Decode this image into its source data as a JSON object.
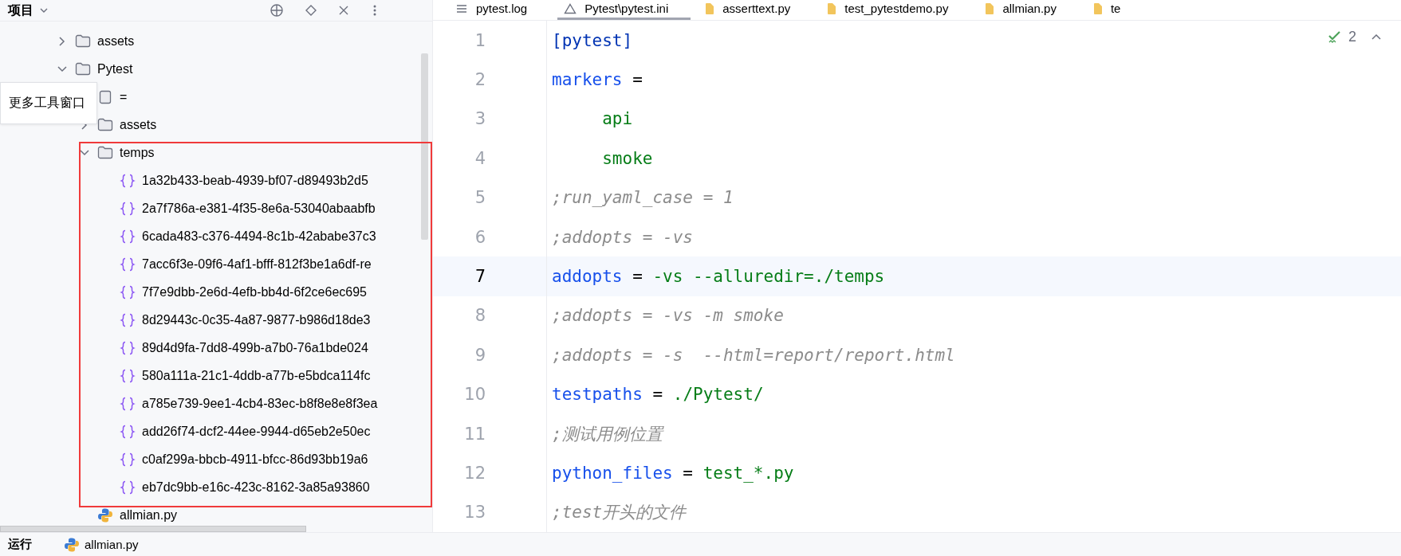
{
  "project_panel": {
    "title": "项目"
  },
  "tree": [
    {
      "label": "assets",
      "kind": "folder",
      "expanded": false
    },
    {
      "label": "Pytest",
      "kind": "folder",
      "expanded": true,
      "children": [
        {
          "label": "=",
          "kind": "file"
        },
        {
          "label": "assets",
          "kind": "folder",
          "expanded": false
        },
        {
          "label": "temps",
          "kind": "folder",
          "expanded": true,
          "children": [
            {
              "label": "1a32b433-beab-4939-bf07-d89493b2d5",
              "kind": "json"
            },
            {
              "label": "2a7f786a-e381-4f35-8e6a-53040abaabfb",
              "kind": "json"
            },
            {
              "label": "6cada483-c376-4494-8c1b-42ababe37c3",
              "kind": "json"
            },
            {
              "label": "7acc6f3e-09f6-4af1-bfff-812f3be1a6df-re",
              "kind": "json"
            },
            {
              "label": "7f7e9dbb-2e6d-4efb-bb4d-6f2ce6ec695",
              "kind": "json"
            },
            {
              "label": "8d29443c-0c35-4a87-9877-b986d18de3",
              "kind": "json"
            },
            {
              "label": "89d4d9fa-7dd8-499b-a7b0-76a1bde024",
              "kind": "json"
            },
            {
              "label": "580a111a-21c1-4ddb-a77b-e5bdca114fc",
              "kind": "json"
            },
            {
              "label": "a785e739-9ee1-4cb4-83ec-b8f8e8e8f3ea",
              "kind": "json"
            },
            {
              "label": "add26f74-dcf2-44ee-9944-d65eb2e50ec",
              "kind": "json"
            },
            {
              "label": "c0af299a-bbcb-4911-bfcc-86d93bb19a6",
              "kind": "json"
            },
            {
              "label": "eb7dc9bb-e16c-423c-8162-3a85a93860",
              "kind": "json"
            }
          ]
        },
        {
          "label": "allmian.py",
          "kind": "python"
        }
      ]
    }
  ],
  "tooltip": {
    "text": "更多工具窗口"
  },
  "tabs": [
    {
      "label": "pytest.log",
      "kind": "log",
      "selected": false
    },
    {
      "label": "Pytest\\pytest.ini",
      "kind": "ini",
      "selected": true
    },
    {
      "label": "asserttext.py",
      "kind": "python",
      "selected": false
    },
    {
      "label": "test_pytestdemo.py",
      "kind": "python",
      "selected": false
    },
    {
      "label": "allmian.py",
      "kind": "python",
      "selected": false
    },
    {
      "label": "te",
      "kind": "python",
      "selected": false
    }
  ],
  "editor": {
    "inspection_count": "2",
    "lines": [
      {
        "number": "1",
        "current": false,
        "tokens": [
          {
            "kind": "section",
            "text": "[pytest]"
          }
        ]
      },
      {
        "number": "2",
        "current": false,
        "tokens": [
          {
            "kind": "key",
            "text": "markers"
          },
          {
            "kind": "op",
            "text": " ="
          }
        ]
      },
      {
        "number": "3",
        "current": false,
        "tokens": [
          {
            "kind": "value",
            "text": "     api"
          }
        ]
      },
      {
        "number": "4",
        "current": false,
        "tokens": [
          {
            "kind": "value",
            "text": "     smoke"
          }
        ]
      },
      {
        "number": "5",
        "current": false,
        "tokens": [
          {
            "kind": "comment",
            "text": ";run_yaml_case = 1"
          }
        ]
      },
      {
        "number": "6",
        "current": false,
        "tokens": [
          {
            "kind": "comment",
            "text": ";addopts = -vs"
          }
        ]
      },
      {
        "number": "7",
        "current": true,
        "tokens": [
          {
            "kind": "key",
            "text": "addopts"
          },
          {
            "kind": "op",
            "text": " = "
          },
          {
            "kind": "value",
            "text": "-vs --alluredir=./temps"
          }
        ]
      },
      {
        "number": "8",
        "current": false,
        "tokens": [
          {
            "kind": "comment",
            "text": ";addopts = -vs -m smoke"
          }
        ]
      },
      {
        "number": "9",
        "current": false,
        "tokens": [
          {
            "kind": "comment",
            "text": ";addopts = -s  --html=report/report.html"
          }
        ]
      },
      {
        "number": "10",
        "current": false,
        "tokens": [
          {
            "kind": "key",
            "text": "testpaths"
          },
          {
            "kind": "op",
            "text": " = "
          },
          {
            "kind": "value",
            "text": "./Pytest/"
          }
        ]
      },
      {
        "number": "11",
        "current": false,
        "tokens": [
          {
            "kind": "comment",
            "text": ";测试用例位置"
          }
        ]
      },
      {
        "number": "12",
        "current": false,
        "tokens": [
          {
            "kind": "key",
            "text": "python_files"
          },
          {
            "kind": "op",
            "text": " = "
          },
          {
            "kind": "value",
            "text": "test_*.py"
          }
        ]
      },
      {
        "number": "13",
        "current": false,
        "tokens": [
          {
            "kind": "comment",
            "text": ";test开头的文件"
          }
        ]
      }
    ]
  },
  "bottom_bar": {
    "tool": "运行",
    "file": "allmian.py"
  }
}
